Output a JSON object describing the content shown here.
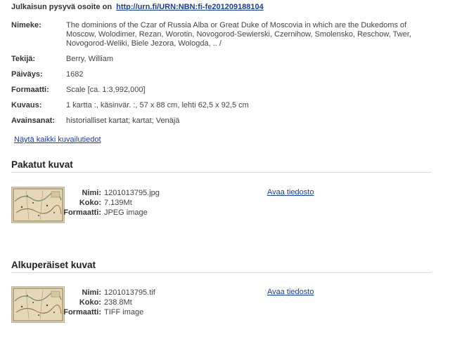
{
  "permalink": {
    "label": "Julkaisun pysyvä osoite on",
    "url": "http://urn.fi/URN:NBN:fi-fe201209188104"
  },
  "metadata": [
    {
      "key": "Nimeke:",
      "value": "The dominions of the Czar of Russia Alba or Great Duke of Moscovia in which are the Dukedoms of Moscow, Wolodimer, Rezan, Worotin, Novogorod-Sewierski, Czernihow, Smolensko, Reschow, Twer, Novogorod-Weliki, Biele Jezora, Wologda, .. /"
    },
    {
      "key": "Tekijä:",
      "value": "Berry, William"
    },
    {
      "key": "Päiväys:",
      "value": "1682"
    },
    {
      "key": "Formaatti:",
      "value": "Scale [ca. 1:3,992,000]"
    },
    {
      "key": "Kuvaus:",
      "value": "1 kartta :, käsinvär. :, 57 x 88 cm, lehti 62,5 x 92,5 cm"
    },
    {
      "key": "Avainsanat:",
      "value": "historialliset kartat; kartat; Venäjä"
    }
  ],
  "show_all_link": "Näytä kaikki kuvailutiedot",
  "sections": [
    {
      "title": "Pakatut kuvat",
      "file": {
        "name_label": "Nimi:",
        "name": "1201013795.jpg",
        "size_label": "Koko:",
        "size": "7.139Mt",
        "format_label": "Formaatti:",
        "format": "JPEG image"
      },
      "open_link": "Avaa tiedosto"
    },
    {
      "title": "Alkuperäiset kuvat",
      "file": {
        "name_label": "Nimi:",
        "name": "1201013795.tif",
        "size_label": "Koko:",
        "size": "238.8Mt",
        "format_label": "Formaatti:",
        "format": "TIFF image"
      },
      "open_link": "Avaa tiedosto"
    }
  ],
  "colors": {
    "link": "#1a3f9a",
    "rule": "#dcdcdc",
    "map_paper": "#e6dcc0"
  },
  "icons": {
    "thumbnail": "map-thumbnail"
  }
}
